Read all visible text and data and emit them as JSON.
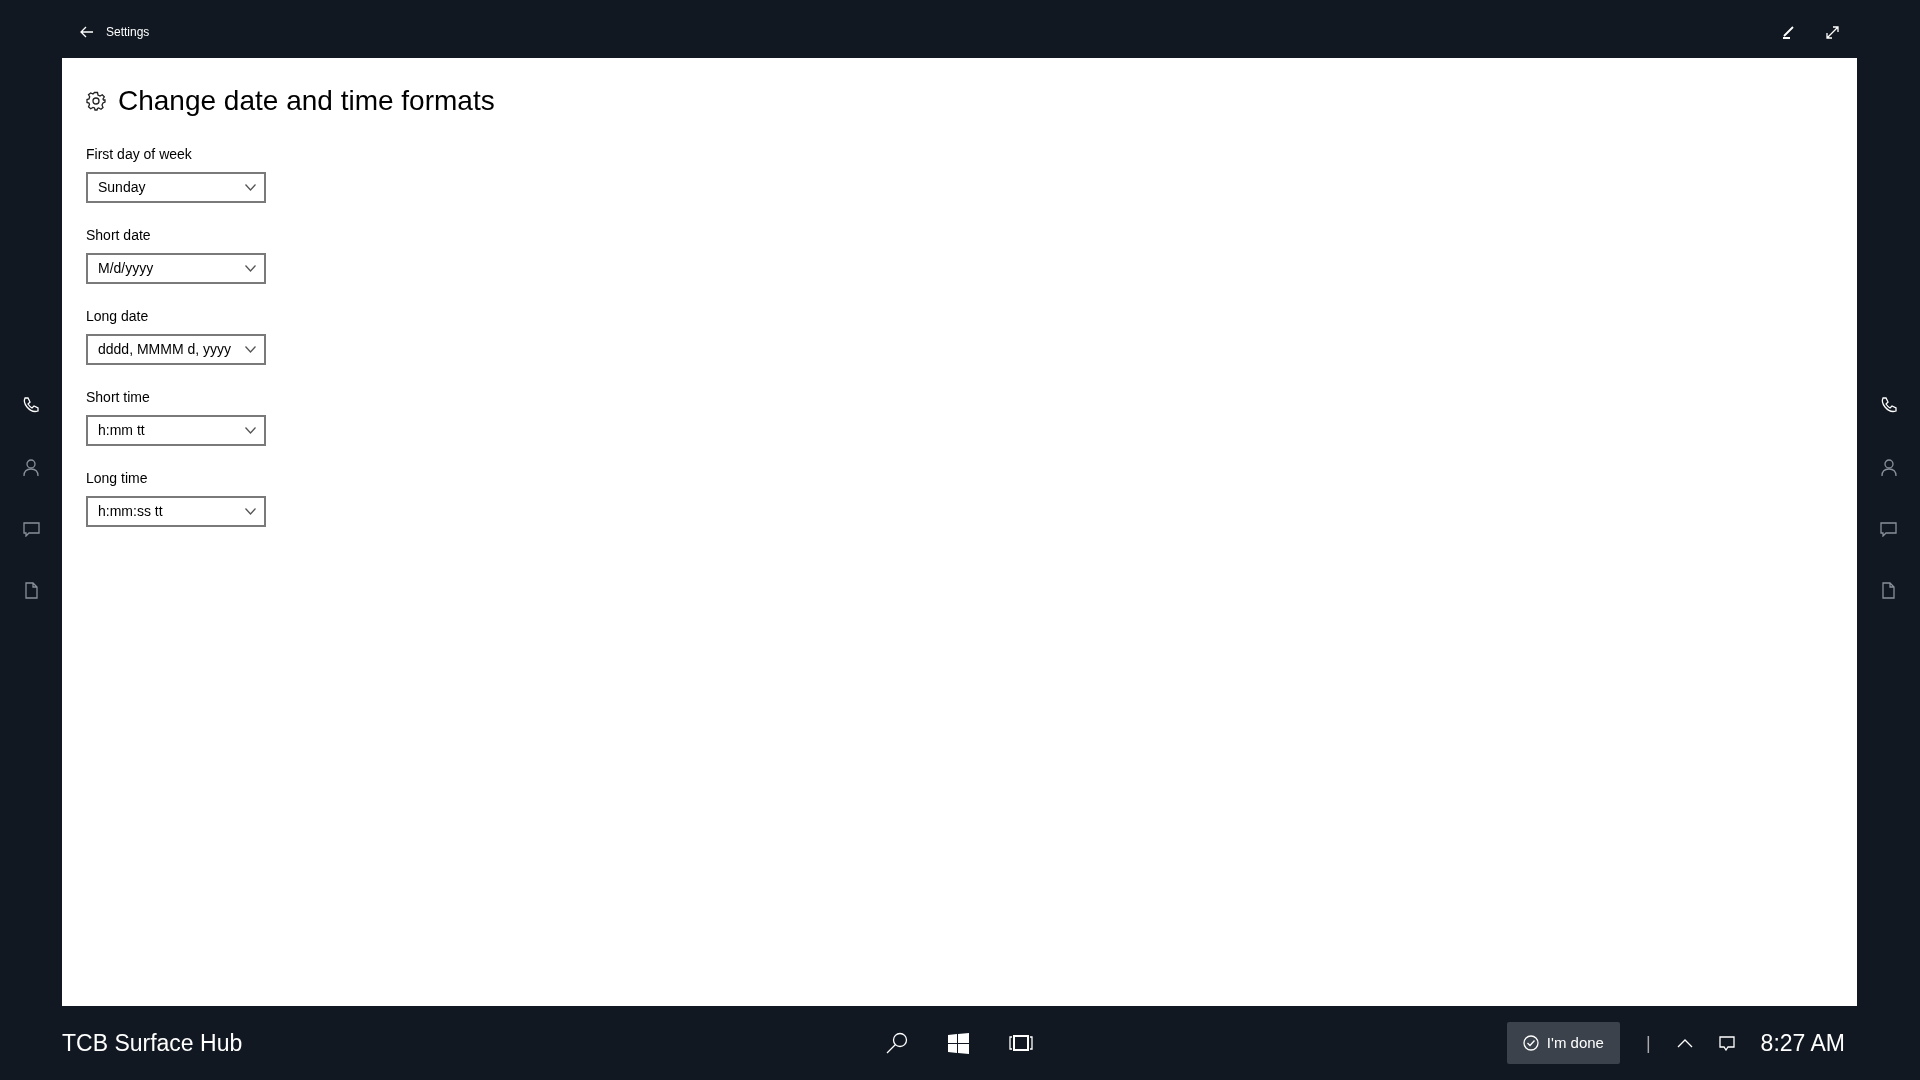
{
  "window": {
    "title": "Settings"
  },
  "page": {
    "title": "Change date and time formats"
  },
  "fields": [
    {
      "label": "First day of week",
      "value": "Sunday"
    },
    {
      "label": "Short date",
      "value": "M/d/yyyy"
    },
    {
      "label": "Long date",
      "value": "dddd, MMMM d, yyyy"
    },
    {
      "label": "Short time",
      "value": "h:mm tt"
    },
    {
      "label": "Long time",
      "value": "h:mm:ss tt"
    }
  ],
  "taskbar": {
    "device_name": "TCB Surface Hub",
    "done_button": "I'm done",
    "separator": "|",
    "clock": "8:27 AM"
  }
}
